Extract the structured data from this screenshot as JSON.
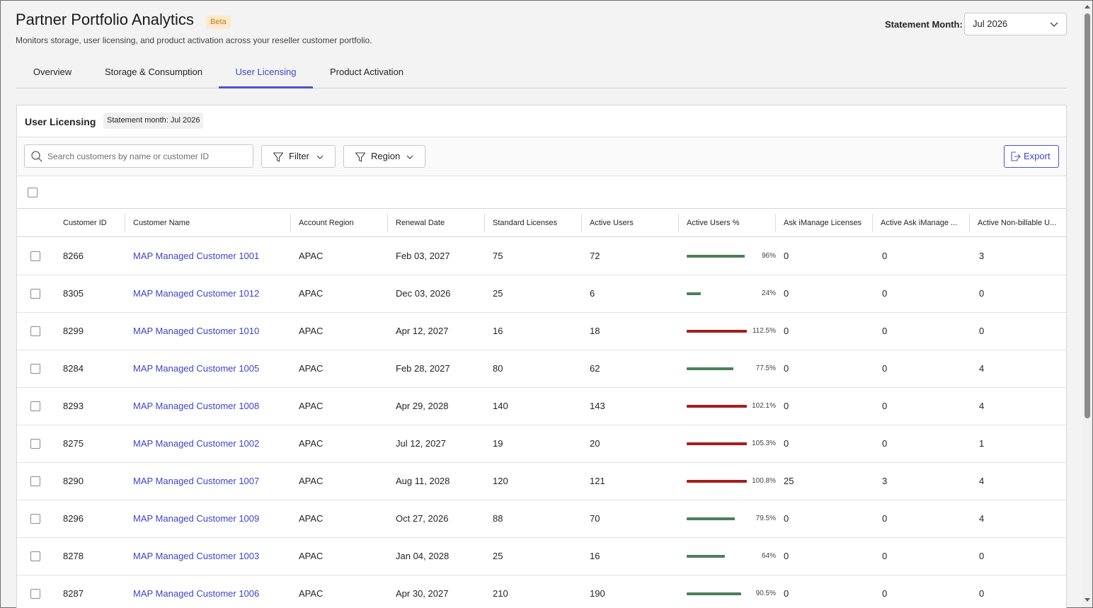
{
  "header": {
    "title": "Partner Portfolio Analytics",
    "badge": "Beta",
    "subtitle": "Monitors storage, user licensing, and product activation across your reseller customer portfolio.",
    "statement_month_label": "Statement Month:",
    "statement_month_value": "Jul 2026"
  },
  "tabs": [
    {
      "label": "Overview",
      "active": false
    },
    {
      "label": "Storage & Consumption",
      "active": false
    },
    {
      "label": "User Licensing",
      "active": true
    },
    {
      "label": "Product Activation",
      "active": false
    }
  ],
  "panel": {
    "title": "User Licensing",
    "statement_badge": "Statement month: Jul 2026",
    "search_placeholder": "Search customers by name or customer ID",
    "filter_label": "Filter",
    "region_label": "Region",
    "export_label": "Export"
  },
  "table": {
    "columns": [
      "Customer ID",
      "Customer Name",
      "Account Region",
      "Renewal Date",
      "Standard Licenses",
      "Active Users",
      "Active Users %",
      "Ask iManage Licenses",
      "Active Ask iManage ...",
      "Active Non-billable U..."
    ],
    "rows": [
      {
        "id": "8266",
        "name": "MAP Managed Customer 1001",
        "region": "APAC",
        "renewal": "Feb 03, 2027",
        "std": "75",
        "active": "72",
        "pct_label": "96%",
        "pct": 96,
        "over": false,
        "ask": "0",
        "active_ask": "0",
        "nonbill": "3"
      },
      {
        "id": "8305",
        "name": "MAP Managed Customer 1012",
        "region": "APAC",
        "renewal": "Dec 03, 2026",
        "std": "25",
        "active": "6",
        "pct_label": "24%",
        "pct": 24,
        "over": false,
        "ask": "0",
        "active_ask": "0",
        "nonbill": "0"
      },
      {
        "id": "8299",
        "name": "MAP Managed Customer 1010",
        "region": "APAC",
        "renewal": "Apr 12, 2027",
        "std": "16",
        "active": "18",
        "pct_label": "112.5%",
        "pct": 112.5,
        "over": true,
        "ask": "0",
        "active_ask": "0",
        "nonbill": "0"
      },
      {
        "id": "8284",
        "name": "MAP Managed Customer 1005",
        "region": "APAC",
        "renewal": "Feb 28, 2027",
        "std": "80",
        "active": "62",
        "pct_label": "77.5%",
        "pct": 77.5,
        "over": false,
        "ask": "0",
        "active_ask": "0",
        "nonbill": "4"
      },
      {
        "id": "8293",
        "name": "MAP Managed Customer 1008",
        "region": "APAC",
        "renewal": "Apr 29, 2028",
        "std": "140",
        "active": "143",
        "pct_label": "102.1%",
        "pct": 102.1,
        "over": true,
        "ask": "0",
        "active_ask": "0",
        "nonbill": "4"
      },
      {
        "id": "8275",
        "name": "MAP Managed Customer 1002",
        "region": "APAC",
        "renewal": "Jul 12, 2027",
        "std": "19",
        "active": "20",
        "pct_label": "105.3%",
        "pct": 105.3,
        "over": true,
        "ask": "0",
        "active_ask": "0",
        "nonbill": "1"
      },
      {
        "id": "8290",
        "name": "MAP Managed Customer 1007",
        "region": "APAC",
        "renewal": "Aug 11, 2028",
        "std": "120",
        "active": "121",
        "pct_label": "100.8%",
        "pct": 100.8,
        "over": true,
        "ask": "25",
        "active_ask": "3",
        "nonbill": "4"
      },
      {
        "id": "8296",
        "name": "MAP Managed Customer 1009",
        "region": "APAC",
        "renewal": "Oct 27, 2026",
        "std": "88",
        "active": "70",
        "pct_label": "79.5%",
        "pct": 79.5,
        "over": false,
        "ask": "0",
        "active_ask": "0",
        "nonbill": "4"
      },
      {
        "id": "8278",
        "name": "MAP Managed Customer 1003",
        "region": "APAC",
        "renewal": "Jan 04, 2028",
        "std": "25",
        "active": "16",
        "pct_label": "64%",
        "pct": 64,
        "over": false,
        "ask": "0",
        "active_ask": "0",
        "nonbill": "0"
      },
      {
        "id": "8287",
        "name": "MAP Managed Customer 1006",
        "region": "APAC",
        "renewal": "Apr 30, 2027",
        "std": "210",
        "active": "190",
        "pct_label": "90.5%",
        "pct": 90.5,
        "over": false,
        "ask": "0",
        "active_ask": "0",
        "nonbill": "0"
      }
    ]
  },
  "colors": {
    "accent": "#4f52d3",
    "bar_ok": "#4a8059",
    "bar_over": "#a81c1c"
  }
}
